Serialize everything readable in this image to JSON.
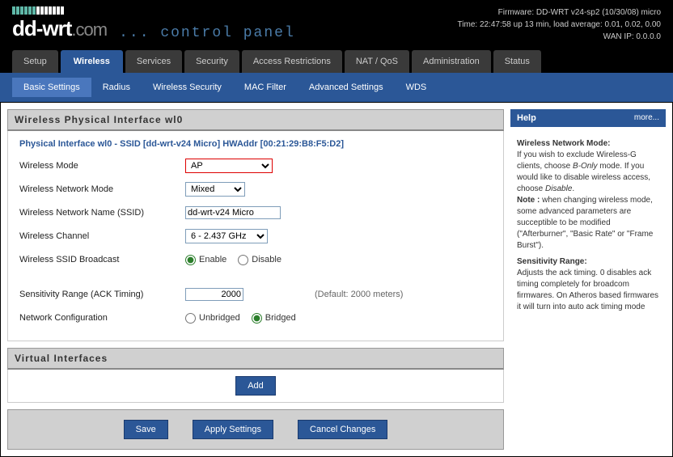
{
  "header": {
    "firmware": "Firmware: DD-WRT v24-sp2 (10/30/08) micro",
    "time": "Time: 22:47:58 up 13 min, load average: 0.01, 0.02, 0.00",
    "wanip": "WAN IP: 0.0.0.0",
    "logo1": "dd-wrt",
    "logo2": ".com",
    "subtitle": "... control panel"
  },
  "tabs": {
    "main": [
      "Setup",
      "Wireless",
      "Services",
      "Security",
      "Access Restrictions",
      "NAT / QoS",
      "Administration",
      "Status"
    ],
    "active_main": "Wireless",
    "sub": [
      "Basic Settings",
      "Radius",
      "Wireless Security",
      "MAC Filter",
      "Advanced Settings",
      "WDS"
    ],
    "active_sub": "Basic Settings"
  },
  "main": {
    "section_title": "Wireless Physical Interface wl0",
    "iface_line": "Physical Interface wl0 - SSID [dd-wrt-v24 Micro] HWAddr [00:21:29:B8:F5:D2]",
    "labels": {
      "mode": "Wireless Mode",
      "netmode": "Wireless Network Mode",
      "ssid": "Wireless Network Name (SSID)",
      "channel": "Wireless Channel",
      "broadcast": "Wireless SSID Broadcast",
      "ack": "Sensitivity Range (ACK Timing)",
      "netconf": "Network Configuration"
    },
    "values": {
      "mode": "AP",
      "netmode": "Mixed",
      "ssid": "dd-wrt-v24 Micro",
      "channel": "6 - 2.437 GHz",
      "ack": "2000",
      "default_ack": "(Default: 2000 meters)"
    },
    "radio": {
      "enable": "Enable",
      "disable": "Disable",
      "unbridged": "Unbridged",
      "bridged": "Bridged"
    },
    "virtual_title": "Virtual Interfaces",
    "add": "Add"
  },
  "buttons": {
    "save": "Save",
    "apply": "Apply Settings",
    "cancel": "Cancel Changes"
  },
  "help": {
    "title": "Help",
    "more": "more...",
    "h1": "Wireless Network Mode:",
    "p1a": "If you wish to exclude Wireless-G clients, choose ",
    "p1b": "B-Only",
    "p1c": " mode. If you would like to disable wireless access, choose ",
    "p1d": "Disable",
    "p1e": ".",
    "note_label": "Note : ",
    "note_text": "when changing wireless mode, some advanced parameters are succeptible to be modified (\"Afterburner\", \"Basic Rate\" or \"Frame Burst\").",
    "h2": "Sensitivity Range:",
    "p2": "Adjusts the ack timing. 0 disables ack timing completely for broadcom firmwares. On Atheros based firmwares it will turn into auto ack timing mode"
  }
}
